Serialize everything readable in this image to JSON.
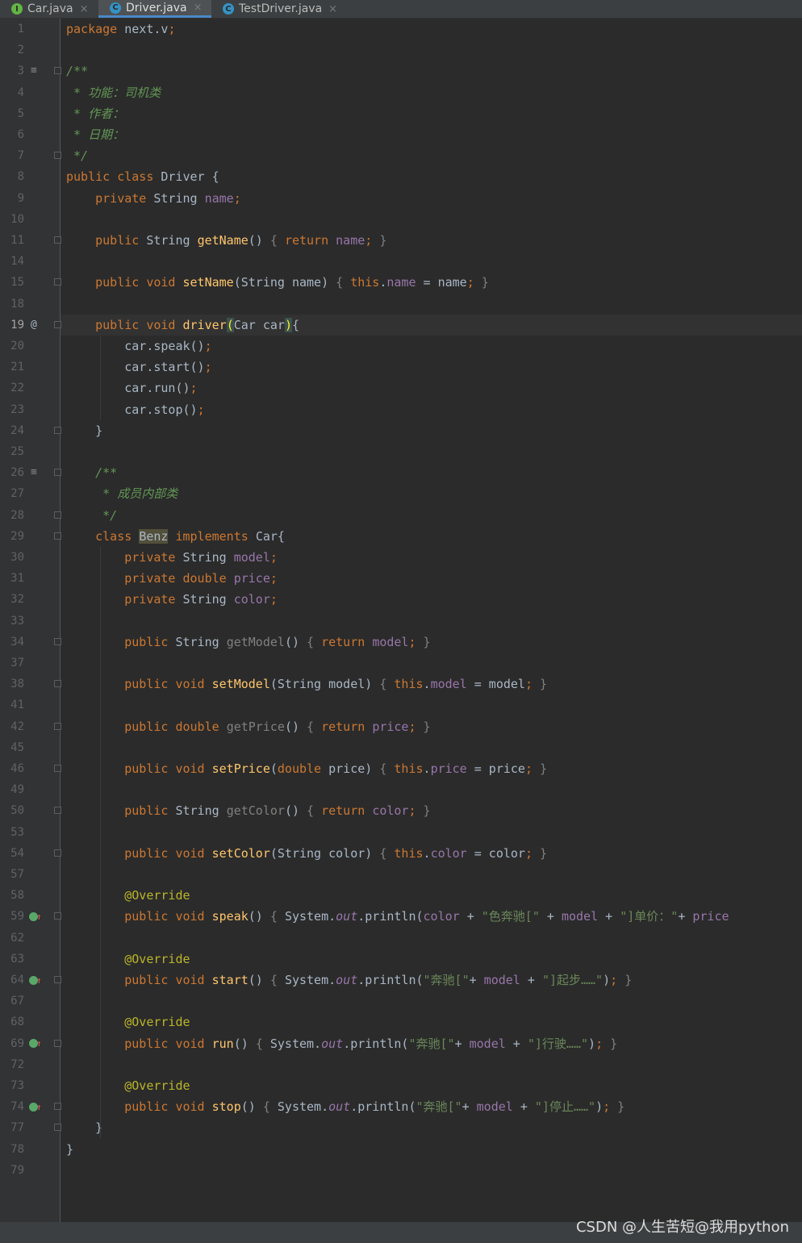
{
  "tabs": [
    {
      "icon": "I",
      "icon_color": "#62b543",
      "label": "Car.java",
      "active": false
    },
    {
      "icon": "C",
      "icon_color": "#3592c4",
      "label": "Driver.java",
      "active": true
    },
    {
      "icon": "C",
      "icon_color": "#3592c4",
      "label": "TestDriver.java",
      "active": false
    }
  ],
  "close_glyph": "×",
  "gutter_icons": {
    "implements_marker": "≡",
    "override_marker": "O↑",
    "at_marker": "@"
  },
  "lines": [
    {
      "n": "1",
      "tokens": [
        [
          "k",
          "package "
        ],
        [
          "t",
          "next.v"
        ],
        [
          "k",
          ";"
        ]
      ]
    },
    {
      "n": "2",
      "tokens": []
    },
    {
      "n": "3",
      "tokens": [
        [
          "c",
          "/**"
        ]
      ]
    },
    {
      "n": "4",
      "tokens": [
        [
          "c",
          " * 功能：司机类"
        ]
      ]
    },
    {
      "n": "5",
      "tokens": [
        [
          "c",
          " * 作者："
        ]
      ]
    },
    {
      "n": "6",
      "tokens": [
        [
          "c",
          " * 日期："
        ]
      ]
    },
    {
      "n": "7",
      "tokens": [
        [
          "c",
          " */"
        ]
      ]
    },
    {
      "n": "8",
      "tokens": [
        [
          "k",
          "public class "
        ],
        [
          "t",
          "Driver {"
        ]
      ]
    },
    {
      "n": "9",
      "tokens": [
        [
          "t",
          "    "
        ],
        [
          "k",
          "private "
        ],
        [
          "t",
          "String "
        ],
        [
          "fd",
          "name"
        ],
        [
          "k",
          ";"
        ]
      ]
    },
    {
      "n": "10",
      "tokens": []
    },
    {
      "n": "11",
      "tokens": [
        [
          "t",
          "    "
        ],
        [
          "k",
          "public "
        ],
        [
          "t",
          "String "
        ],
        [
          "f",
          "getName"
        ],
        [
          "t",
          "() "
        ],
        [
          "g",
          "{ "
        ],
        [
          "k",
          "return "
        ],
        [
          "fd",
          "name"
        ],
        [
          "k",
          "; "
        ],
        [
          "g",
          "}"
        ]
      ]
    },
    {
      "n": "14",
      "tokens": []
    },
    {
      "n": "15",
      "tokens": [
        [
          "t",
          "    "
        ],
        [
          "k",
          "public void "
        ],
        [
          "f",
          "setName"
        ],
        [
          "t",
          "(String name) "
        ],
        [
          "g",
          "{ "
        ],
        [
          "k",
          "this"
        ],
        [
          "t",
          "."
        ],
        [
          "fd",
          "name"
        ],
        [
          "t",
          " = name"
        ],
        [
          "k",
          "; "
        ],
        [
          "g",
          "}"
        ]
      ]
    },
    {
      "n": "18",
      "tokens": []
    },
    {
      "n": "19",
      "tokens": [
        [
          "t",
          "    "
        ],
        [
          "k",
          "public void "
        ],
        [
          "f",
          "driver"
        ],
        [
          "brace",
          "("
        ],
        [
          "t",
          "Car car"
        ],
        [
          "brace",
          ")"
        ],
        [
          "t",
          "{"
        ]
      ]
    },
    {
      "n": "20",
      "tokens": [
        [
          "t",
          "        car.speak()"
        ],
        [
          "k",
          ";"
        ]
      ]
    },
    {
      "n": "21",
      "tokens": [
        [
          "t",
          "        car.start()"
        ],
        [
          "k",
          ";"
        ]
      ]
    },
    {
      "n": "22",
      "tokens": [
        [
          "t",
          "        car.run()"
        ],
        [
          "k",
          ";"
        ]
      ]
    },
    {
      "n": "23",
      "tokens": [
        [
          "t",
          "        car.stop()"
        ],
        [
          "k",
          ";"
        ]
      ]
    },
    {
      "n": "24",
      "tokens": [
        [
          "t",
          "    }"
        ]
      ]
    },
    {
      "n": "25",
      "tokens": []
    },
    {
      "n": "26",
      "tokens": [
        [
          "c",
          "    /**"
        ]
      ]
    },
    {
      "n": "27",
      "tokens": [
        [
          "c",
          "     * 成员内部类"
        ]
      ]
    },
    {
      "n": "28",
      "tokens": [
        [
          "c",
          "     */"
        ]
      ]
    },
    {
      "n": "29",
      "tokens": [
        [
          "t",
          "    "
        ],
        [
          "k",
          "class "
        ],
        [
          "hl",
          "Benz"
        ],
        [
          "k",
          " implements "
        ],
        [
          "t",
          "Car{"
        ]
      ]
    },
    {
      "n": "30",
      "tokens": [
        [
          "t",
          "        "
        ],
        [
          "k",
          "private "
        ],
        [
          "t",
          "String "
        ],
        [
          "fd",
          "model"
        ],
        [
          "k",
          ";"
        ]
      ]
    },
    {
      "n": "31",
      "tokens": [
        [
          "t",
          "        "
        ],
        [
          "k",
          "private double "
        ],
        [
          "fd",
          "price"
        ],
        [
          "k",
          ";"
        ]
      ]
    },
    {
      "n": "32",
      "tokens": [
        [
          "t",
          "        "
        ],
        [
          "k",
          "private "
        ],
        [
          "t",
          "String "
        ],
        [
          "fd",
          "color"
        ],
        [
          "k",
          ";"
        ]
      ]
    },
    {
      "n": "33",
      "tokens": []
    },
    {
      "n": "34",
      "tokens": [
        [
          "t",
          "        "
        ],
        [
          "k",
          "public "
        ],
        [
          "t",
          "String "
        ],
        [
          "g",
          "getModel"
        ],
        [
          "t",
          "() "
        ],
        [
          "g",
          "{ "
        ],
        [
          "k",
          "return "
        ],
        [
          "fd",
          "model"
        ],
        [
          "k",
          "; "
        ],
        [
          "g",
          "}"
        ]
      ]
    },
    {
      "n": "37",
      "tokens": []
    },
    {
      "n": "38",
      "tokens": [
        [
          "t",
          "        "
        ],
        [
          "k",
          "public void "
        ],
        [
          "f",
          "setModel"
        ],
        [
          "t",
          "(String model) "
        ],
        [
          "g",
          "{ "
        ],
        [
          "k",
          "this"
        ],
        [
          "t",
          "."
        ],
        [
          "fd",
          "model"
        ],
        [
          "t",
          " = model"
        ],
        [
          "k",
          "; "
        ],
        [
          "g",
          "}"
        ]
      ]
    },
    {
      "n": "41",
      "tokens": []
    },
    {
      "n": "42",
      "tokens": [
        [
          "t",
          "        "
        ],
        [
          "k",
          "public double "
        ],
        [
          "g",
          "getPrice"
        ],
        [
          "t",
          "() "
        ],
        [
          "g",
          "{ "
        ],
        [
          "k",
          "return "
        ],
        [
          "fd",
          "price"
        ],
        [
          "k",
          "; "
        ],
        [
          "g",
          "}"
        ]
      ]
    },
    {
      "n": "45",
      "tokens": []
    },
    {
      "n": "46",
      "tokens": [
        [
          "t",
          "        "
        ],
        [
          "k",
          "public void "
        ],
        [
          "f",
          "setPrice"
        ],
        [
          "t",
          "("
        ],
        [
          "k",
          "double "
        ],
        [
          "t",
          "price) "
        ],
        [
          "g",
          "{ "
        ],
        [
          "k",
          "this"
        ],
        [
          "t",
          "."
        ],
        [
          "fd",
          "price"
        ],
        [
          "t",
          " = price"
        ],
        [
          "k",
          "; "
        ],
        [
          "g",
          "}"
        ]
      ]
    },
    {
      "n": "49",
      "tokens": []
    },
    {
      "n": "50",
      "tokens": [
        [
          "t",
          "        "
        ],
        [
          "k",
          "public "
        ],
        [
          "t",
          "String "
        ],
        [
          "g",
          "getColor"
        ],
        [
          "t",
          "() "
        ],
        [
          "g",
          "{ "
        ],
        [
          "k",
          "return "
        ],
        [
          "fd",
          "color"
        ],
        [
          "k",
          "; "
        ],
        [
          "g",
          "}"
        ]
      ]
    },
    {
      "n": "53",
      "tokens": []
    },
    {
      "n": "54",
      "tokens": [
        [
          "t",
          "        "
        ],
        [
          "k",
          "public void "
        ],
        [
          "f",
          "setColor"
        ],
        [
          "t",
          "(String color) "
        ],
        [
          "g",
          "{ "
        ],
        [
          "k",
          "this"
        ],
        [
          "t",
          "."
        ],
        [
          "fd",
          "color"
        ],
        [
          "t",
          " = color"
        ],
        [
          "k",
          "; "
        ],
        [
          "g",
          "}"
        ]
      ]
    },
    {
      "n": "57",
      "tokens": []
    },
    {
      "n": "58",
      "tokens": [
        [
          "t",
          "        "
        ],
        [
          "a",
          "@Override"
        ]
      ]
    },
    {
      "n": "59",
      "tokens": [
        [
          "t",
          "        "
        ],
        [
          "k",
          "public void "
        ],
        [
          "f",
          "speak"
        ],
        [
          "t",
          "() "
        ],
        [
          "g",
          "{ "
        ],
        [
          "t",
          "System."
        ],
        [
          "st",
          "out"
        ],
        [
          "t",
          ".println("
        ],
        [
          "fd",
          "color"
        ],
        [
          "t",
          " + "
        ],
        [
          "s",
          "\"色奔驰[\""
        ],
        [
          "t",
          " + "
        ],
        [
          "fd",
          "model"
        ],
        [
          "t",
          " + "
        ],
        [
          "s",
          "\"]单价：\""
        ],
        [
          "t",
          "+ "
        ],
        [
          "fd",
          "price"
        ]
      ]
    },
    {
      "n": "62",
      "tokens": []
    },
    {
      "n": "63",
      "tokens": [
        [
          "t",
          "        "
        ],
        [
          "a",
          "@Override"
        ]
      ]
    },
    {
      "n": "64",
      "tokens": [
        [
          "t",
          "        "
        ],
        [
          "k",
          "public void "
        ],
        [
          "f",
          "start"
        ],
        [
          "t",
          "() "
        ],
        [
          "g",
          "{ "
        ],
        [
          "t",
          "System."
        ],
        [
          "st",
          "out"
        ],
        [
          "t",
          ".println("
        ],
        [
          "s",
          "\"奔驰[\""
        ],
        [
          "t",
          "+ "
        ],
        [
          "fd",
          "model"
        ],
        [
          "t",
          " + "
        ],
        [
          "s",
          "\"]起步……\""
        ],
        [
          "t",
          ")"
        ],
        [
          "k",
          "; "
        ],
        [
          "g",
          "}"
        ]
      ]
    },
    {
      "n": "67",
      "tokens": []
    },
    {
      "n": "68",
      "tokens": [
        [
          "t",
          "        "
        ],
        [
          "a",
          "@Override"
        ]
      ]
    },
    {
      "n": "69",
      "tokens": [
        [
          "t",
          "        "
        ],
        [
          "k",
          "public void "
        ],
        [
          "f",
          "run"
        ],
        [
          "t",
          "() "
        ],
        [
          "g",
          "{ "
        ],
        [
          "t",
          "System."
        ],
        [
          "st",
          "out"
        ],
        [
          "t",
          ".println("
        ],
        [
          "s",
          "\"奔驰[\""
        ],
        [
          "t",
          "+ "
        ],
        [
          "fd",
          "model"
        ],
        [
          "t",
          " + "
        ],
        [
          "s",
          "\"]行驶……\""
        ],
        [
          "t",
          ")"
        ],
        [
          "k",
          "; "
        ],
        [
          "g",
          "}"
        ]
      ]
    },
    {
      "n": "72",
      "tokens": []
    },
    {
      "n": "73",
      "tokens": [
        [
          "t",
          "        "
        ],
        [
          "a",
          "@Override"
        ]
      ]
    },
    {
      "n": "74",
      "tokens": [
        [
          "t",
          "        "
        ],
        [
          "k",
          "public void "
        ],
        [
          "f",
          "stop"
        ],
        [
          "t",
          "() "
        ],
        [
          "g",
          "{ "
        ],
        [
          "t",
          "System."
        ],
        [
          "st",
          "out"
        ],
        [
          "t",
          ".println("
        ],
        [
          "s",
          "\"奔驰[\""
        ],
        [
          "t",
          "+ "
        ],
        [
          "fd",
          "model"
        ],
        [
          "t",
          " + "
        ],
        [
          "s",
          "\"]停止……\""
        ],
        [
          "t",
          ")"
        ],
        [
          "k",
          "; "
        ],
        [
          "g",
          "}"
        ]
      ]
    },
    {
      "n": "77",
      "tokens": [
        [
          "t",
          "    }"
        ]
      ]
    },
    {
      "n": "78",
      "tokens": [
        [
          "t",
          "}"
        ]
      ]
    },
    {
      "n": "79",
      "tokens": []
    }
  ],
  "current_line": "19",
  "fold_lines": [
    "3",
    "7",
    "11",
    "15",
    "19",
    "24",
    "26",
    "28",
    "29",
    "34",
    "38",
    "42",
    "46",
    "50",
    "54",
    "59",
    "64",
    "69",
    "74",
    "77"
  ],
  "implements_lines": [
    "3",
    "26"
  ],
  "override_lines": [
    "59",
    "64",
    "69",
    "74"
  ],
  "watermark": "CSDN @人生苦短@我用python",
  "colors": {
    "background": "#2b2b2b",
    "keyword": "#cc7832",
    "function": "#ffc66d",
    "field": "#9876aa",
    "comment": "#629755",
    "string": "#6a8759",
    "annotation": "#bbb529"
  }
}
